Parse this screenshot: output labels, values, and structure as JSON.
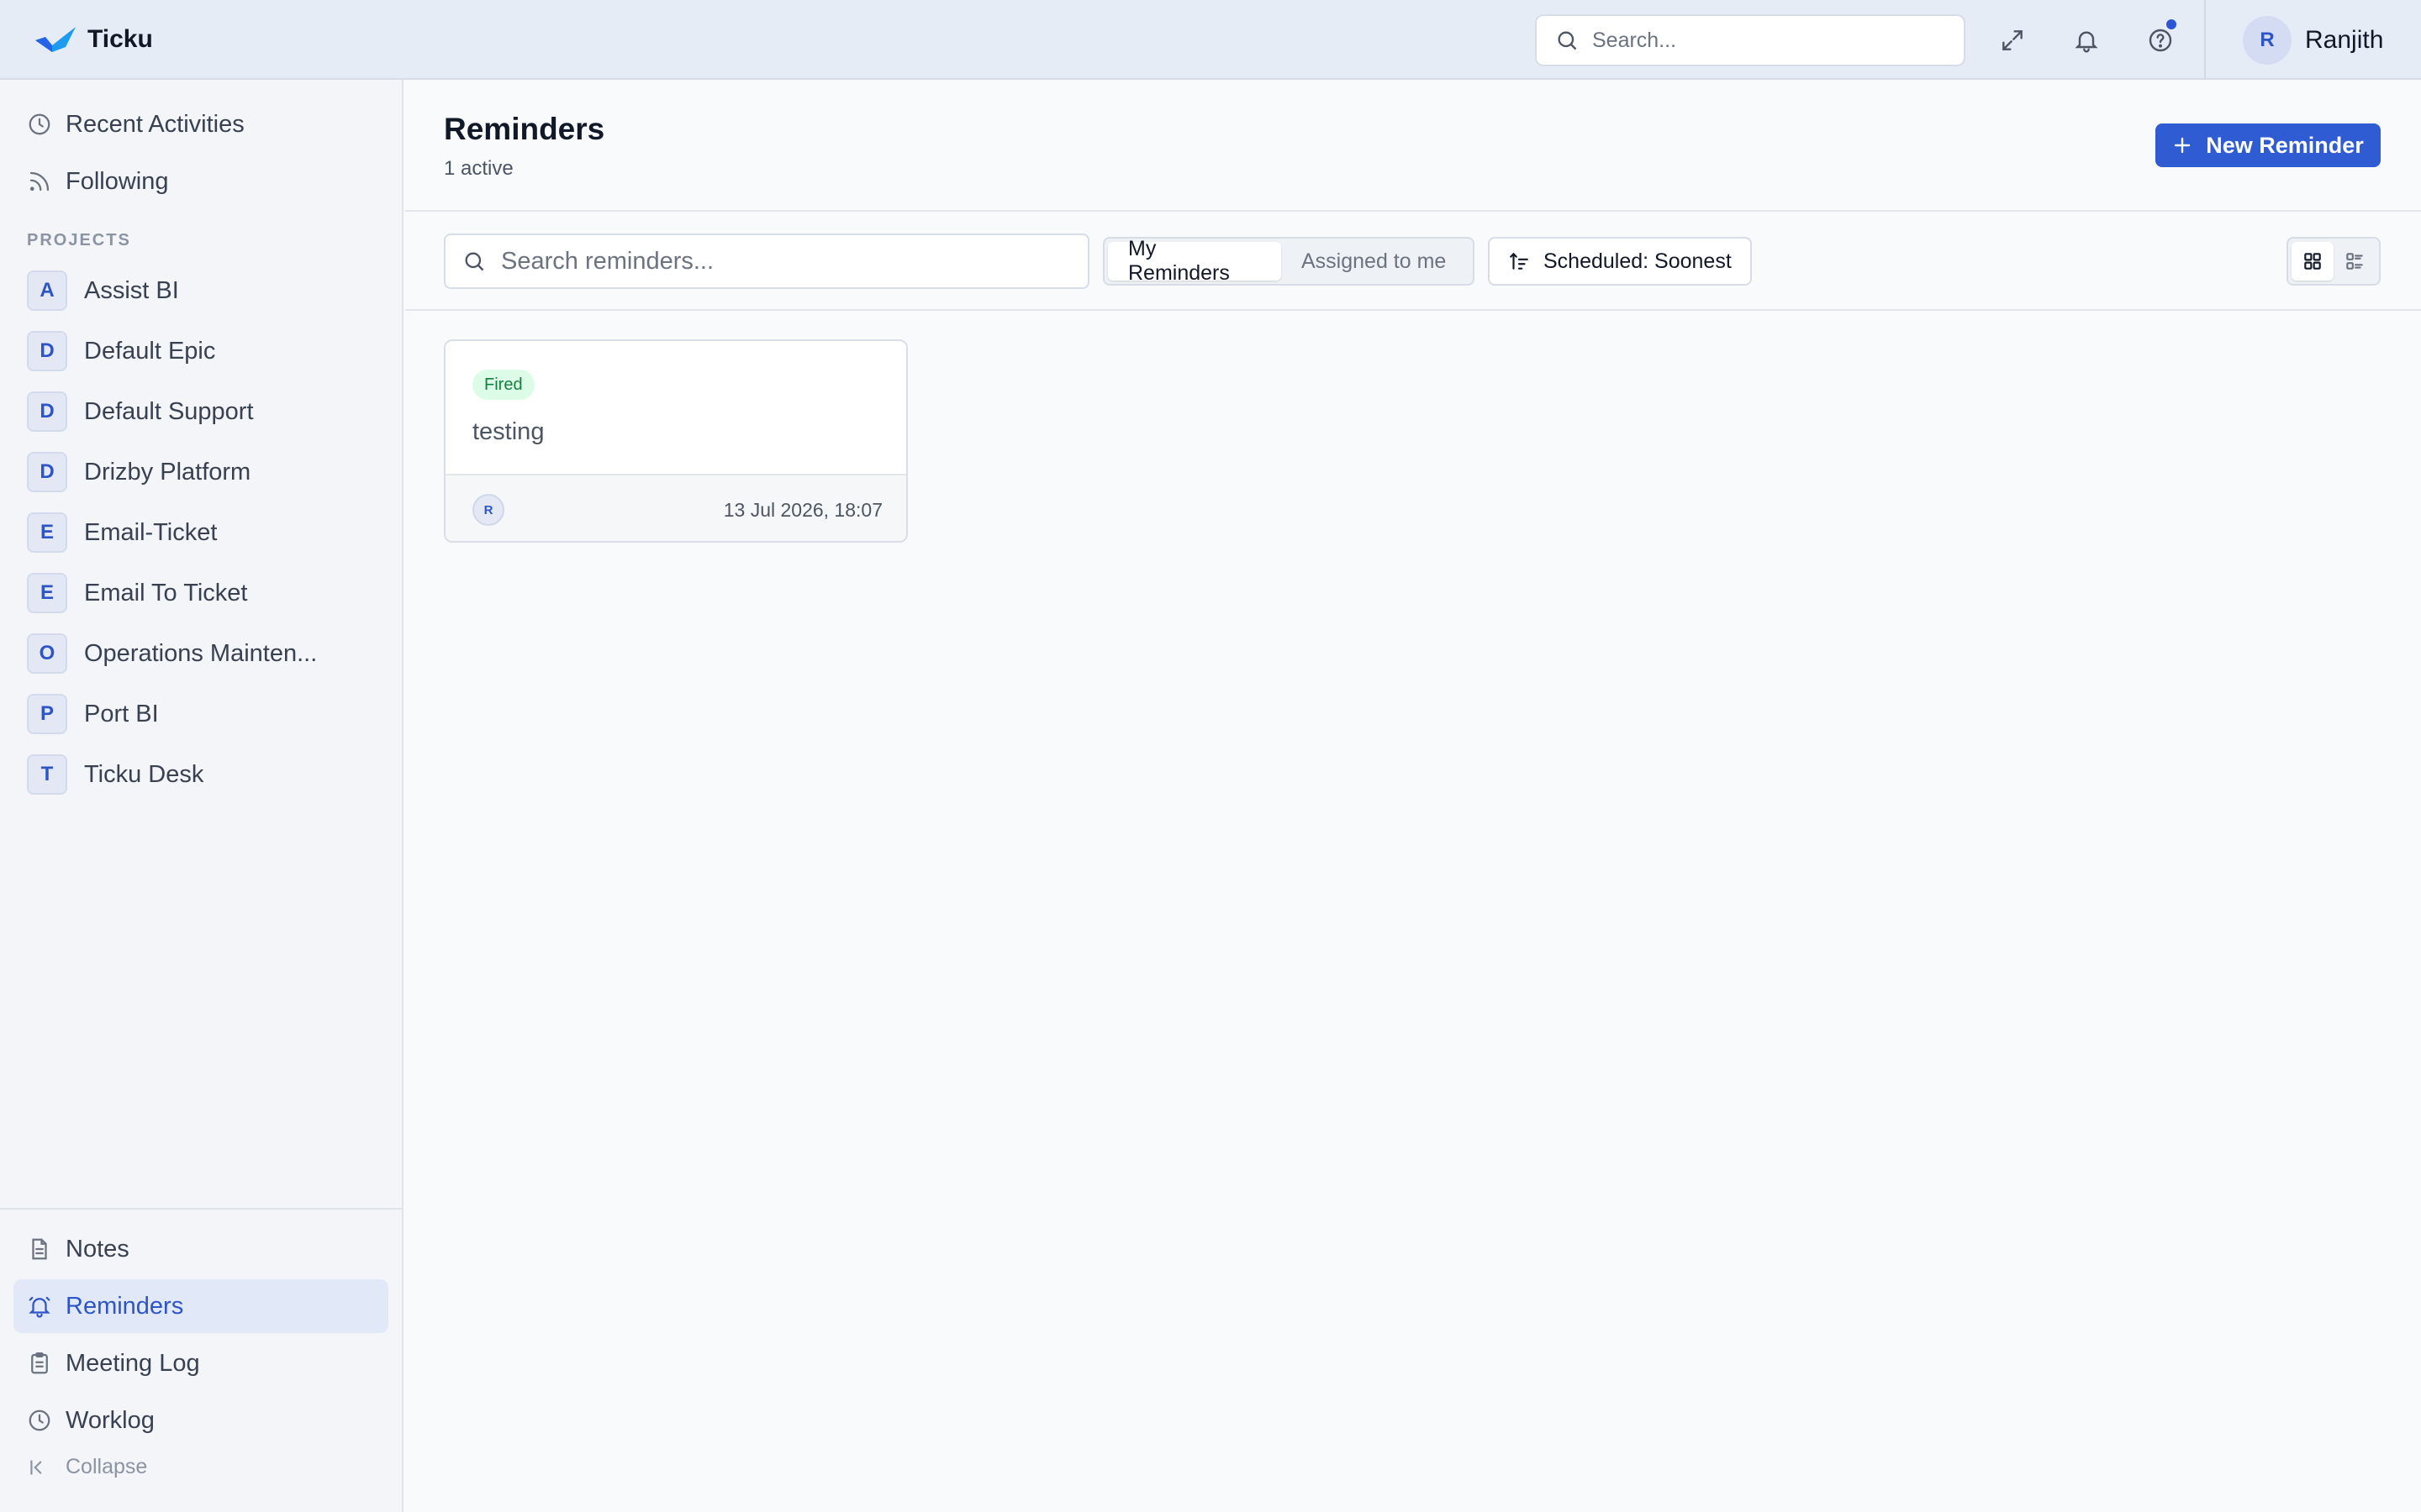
{
  "app": {
    "name": "Ticku"
  },
  "header": {
    "search_placeholder": "Search...",
    "user_initial": "R",
    "user_name": "Ranjith"
  },
  "sidebar": {
    "top_items": [
      {
        "label": "Recent Activities",
        "icon": "clock-icon"
      },
      {
        "label": "Following",
        "icon": "rss-icon"
      }
    ],
    "projects_label": "PROJECTS",
    "projects": [
      {
        "initial": "A",
        "name": "Assist BI"
      },
      {
        "initial": "D",
        "name": "Default Epic"
      },
      {
        "initial": "D",
        "name": "Default Support"
      },
      {
        "initial": "D",
        "name": "Drizby Platform"
      },
      {
        "initial": "E",
        "name": "Email-Ticket"
      },
      {
        "initial": "E",
        "name": "Email To Ticket"
      },
      {
        "initial": "O",
        "name": "Operations Mainten..."
      },
      {
        "initial": "P",
        "name": "Port BI"
      },
      {
        "initial": "T",
        "name": "Ticku Desk"
      }
    ],
    "bottom_items": [
      {
        "label": "Notes",
        "icon": "document-icon"
      },
      {
        "label": "Reminders",
        "icon": "bell-icon",
        "active": true
      },
      {
        "label": "Meeting Log",
        "icon": "clipboard-icon"
      },
      {
        "label": "Worklog",
        "icon": "clock-icon"
      }
    ],
    "collapse_label": "Collapse"
  },
  "main": {
    "title": "Reminders",
    "subtitle": "1 active",
    "new_button_label": "New Reminder",
    "search_placeholder": "Search reminders...",
    "tabs": [
      {
        "label": "My Reminders",
        "active": true
      },
      {
        "label": "Assigned to me",
        "active": false
      }
    ],
    "sort_label": "Scheduled: Soonest",
    "view": "grid"
  },
  "reminders": [
    {
      "status": "Fired",
      "title": "testing",
      "assignee_initial": "R",
      "scheduled": "13 Jul 2026, 18:07"
    }
  ],
  "colors": {
    "accent": "#2f5bd3",
    "fired_bg": "#dcfce7",
    "fired_text": "#15803d"
  }
}
